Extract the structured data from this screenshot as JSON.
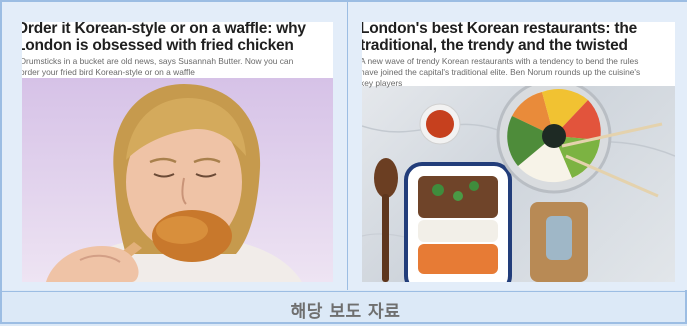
{
  "articles": [
    {
      "headline": "Order it Korean-style or on a waffle: why\nLondon is obsessed with fried chicken",
      "standfirst": "Drumsticks in a bucket are old news, says Susannah Butter. Now you can\norder your fried bird Korean-style or on a waffle",
      "photo": "woman eating fried chicken drumstick"
    },
    {
      "headline": "London's best Korean restaurants: the\ntraditional, the trendy and the twisted",
      "standfirst": "A new wave of trendy Korean restaurants with a tendency to bend the rules\nhave joined the capital's traditional elite. Ben Norum rounds up the cuisine's\nkey players",
      "photo": "Korean bibimbap and bulgogi dishes on marble table"
    }
  ],
  "footer": {
    "label": "해당 보도 자료"
  }
}
